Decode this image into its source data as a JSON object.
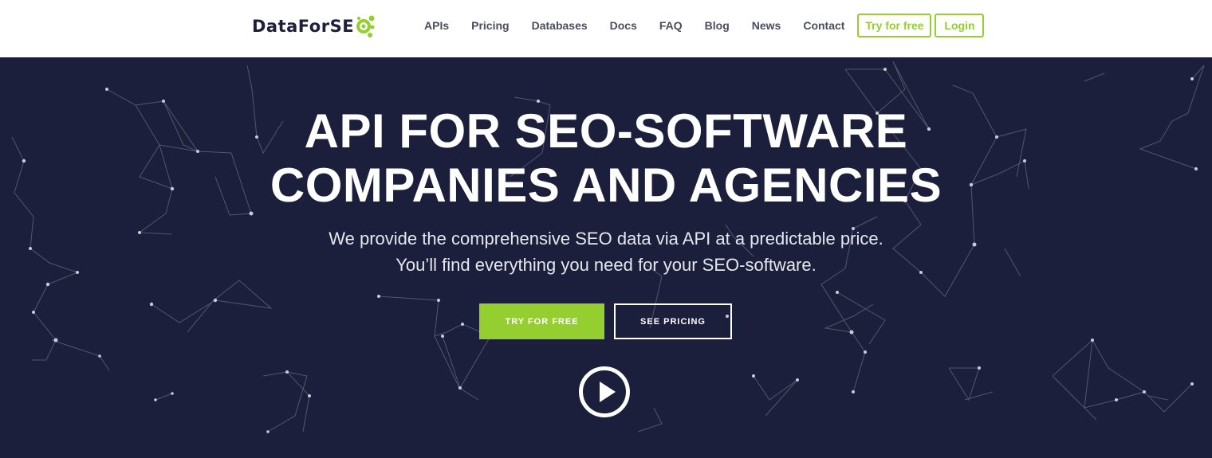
{
  "brand": {
    "logo_part1": "DataFor",
    "logo_part2": "SE",
    "logo_mark": "green-dot-cluster-logo"
  },
  "nav": {
    "items": [
      "APIs",
      "Pricing",
      "Databases",
      "Docs",
      "FAQ",
      "Blog",
      "News",
      "Contact"
    ],
    "try_label": "Try for free",
    "login_label": "Login"
  },
  "hero": {
    "headline_line1": "API FOR SEO-SOFTWARE",
    "headline_line2": "COMPANIES AND AGENCIES",
    "subtitle_line1": "We provide the comprehensive SEO data via API at a predictable price.",
    "subtitle_line2": "You’ll find everything you need for your SEO-software.",
    "cta_try": "TRY FOR FREE",
    "cta_pricing": "SEE PRICING",
    "play_icon": "play-circle-icon",
    "background": "network-particles-pattern"
  },
  "colors": {
    "accent": "#95cf2f",
    "hero_bg": "#1c1f3b",
    "nav_text": "#4a4d5c",
    "white": "#ffffff"
  }
}
